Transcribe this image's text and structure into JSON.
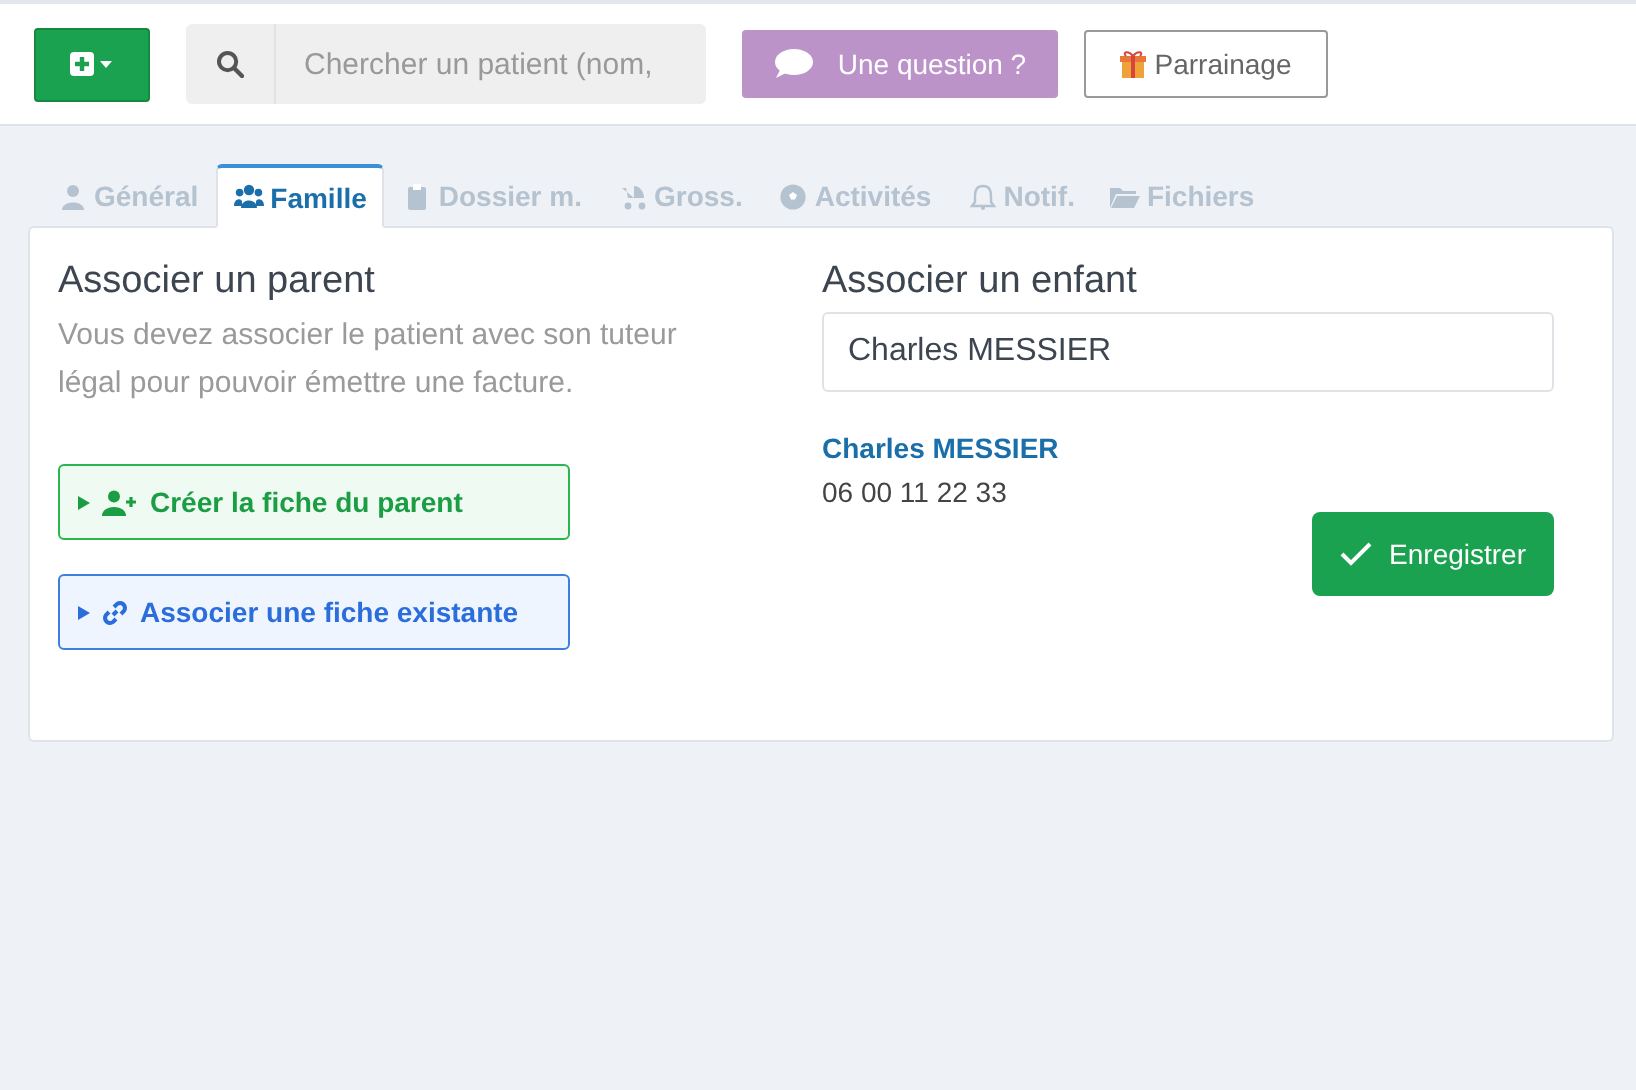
{
  "topbar": {
    "search": {
      "placeholder": "Chercher un patient (nom,"
    },
    "buttons": [
      {
        "label": "Une question ?",
        "kind": "question"
      },
      {
        "label": "Parrainage",
        "kind": "gift"
      }
    ]
  },
  "tabs": [
    {
      "label": "Général",
      "selected": false
    },
    {
      "label": "Famille",
      "selected": true
    },
    {
      "label": "Dossier m.",
      "selected": false
    },
    {
      "label": "Gross.",
      "selected": false
    },
    {
      "label": "Activités",
      "selected": false
    },
    {
      "label": "Notif.",
      "selected": false
    },
    {
      "label": "Fichiers",
      "selected": false
    }
  ],
  "parent_section": {
    "title": "Associer un parent",
    "description": "Vous devez associer le patient avec son tuteur légal pour pouvoir émettre une facture.",
    "actions": [
      {
        "label": "Créer la fiche du parent",
        "kind": "create"
      },
      {
        "label": "Associer une fiche existante",
        "kind": "link"
      }
    ]
  },
  "child_section": {
    "title": "Associer un enfant",
    "search_value": "Charles MESSIER",
    "result": {
      "name": "Charles MESSIER",
      "phone": "06 00 11 22 33"
    },
    "save_button": "Enregistrer"
  }
}
